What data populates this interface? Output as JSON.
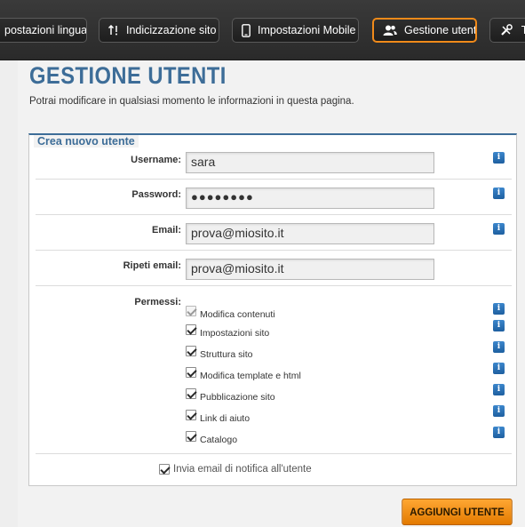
{
  "toolbar": {
    "buttons": [
      {
        "label": "postazioni lingua",
        "icon": "language-icon",
        "active": false
      },
      {
        "label": "Indicizzazione sito",
        "icon": "sort-arrows-icon",
        "active": false
      },
      {
        "label": "Impostazioni Mobile",
        "icon": "mobile-phone-icon",
        "active": false
      },
      {
        "label": "Gestione utenti",
        "icon": "users-icon",
        "active": true
      },
      {
        "label": "Te",
        "icon": "tools-icon",
        "active": false
      }
    ],
    "accent_color": "#f08a1a"
  },
  "page": {
    "title": "GESTIONE UTENTI",
    "subtitle": "Potrai modificare in qualsiasi momento le informazioni in questa pagina.",
    "title_color": "#3d6d98"
  },
  "form": {
    "legend": "Crea nuovo utente",
    "username": {
      "label": "Username:",
      "value": "sara"
    },
    "password": {
      "label": "Password:",
      "value": "●●●●●●●●"
    },
    "email": {
      "label": "Email:",
      "value": "prova@miosito.it"
    },
    "repeat_email": {
      "label": "Ripeti email:",
      "value": "prova@miosito.it"
    },
    "permissions_label": "Permessi:",
    "permissions": [
      {
        "label": "Modifica contenuti",
        "checked": true,
        "disabled": true
      },
      {
        "label": "Impostazioni sito",
        "checked": true,
        "disabled": false
      },
      {
        "label": "Struttura sito",
        "checked": true,
        "disabled": false
      },
      {
        "label": "Modifica template e html",
        "checked": true,
        "disabled": false
      },
      {
        "label": "Pubblicazione sito",
        "checked": true,
        "disabled": false
      },
      {
        "label": "Link di aiuto",
        "checked": true,
        "disabled": false
      },
      {
        "label": "Catalogo",
        "checked": true,
        "disabled": false
      }
    ],
    "notify": {
      "label": "Invia email di notifica all'utente",
      "checked": true
    },
    "info_glyph": "i",
    "submit_label": "AGGIUNGI UTENTE",
    "submit_color": "#f39221"
  }
}
